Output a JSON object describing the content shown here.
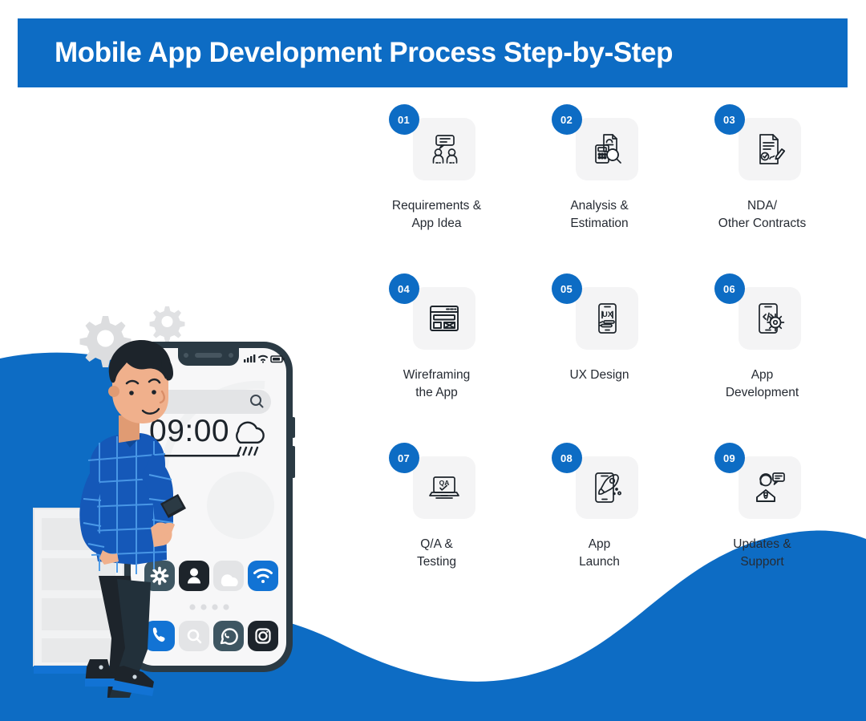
{
  "header": {
    "title": "Mobile App Development Process Step-by-Step",
    "background_color": "#0d6cc4",
    "text_color": "#ffffff"
  },
  "theme": {
    "brand_blue": "#0d6cc4",
    "tile_gray": "#f4f4f5",
    "text_dark": "#262b33",
    "dark_slate": "#2b3a44",
    "near_black": "#1d242b",
    "light_gray": "#e3e4e6"
  },
  "steps": [
    {
      "number": "01",
      "label": "Requirements &\nApp Idea",
      "icon": "people-chat-icon"
    },
    {
      "number": "02",
      "label": "Analysis &\nEstimation",
      "icon": "calculator-magnifier-icon"
    },
    {
      "number": "03",
      "label": "NDA/\nOther Contracts",
      "icon": "contract-signature-icon"
    },
    {
      "number": "04",
      "label": "Wireframing\nthe App",
      "icon": "wireframe-layout-icon"
    },
    {
      "number": "05",
      "label": "UX Design",
      "icon": "phone-ux-icon"
    },
    {
      "number": "06",
      "label": "App\nDevelopment",
      "icon": "phone-code-gear-icon"
    },
    {
      "number": "07",
      "label": "Q/A &\nTesting",
      "icon": "laptop-qa-icon"
    },
    {
      "number": "08",
      "label": "App\nLaunch",
      "icon": "phone-rocket-icon"
    },
    {
      "number": "09",
      "label": "Updates &\nSupport",
      "icon": "support-agent-icon"
    }
  ],
  "illustration": {
    "phone_screen": {
      "clock": "09:00",
      "search_placeholder": "",
      "weather_icon": "rain-cloud-icon",
      "status_icons": [
        "signal-bars-icon",
        "wifi-icon",
        "battery-icon"
      ],
      "app_icons": [
        {
          "name": "settings-gear-icon",
          "color": "#3e5662"
        },
        {
          "name": "contacts-person-icon",
          "color": "#1d242b"
        },
        {
          "name": "cloud-icon",
          "color": "#e3e4e6"
        },
        {
          "name": "wifi-app-icon",
          "color": "#1273d4"
        }
      ],
      "page_dots": 4,
      "dock_icons": [
        {
          "name": "phone-call-icon",
          "color": "#1273d4"
        },
        {
          "name": "search-app-icon",
          "color": "#e3e4e6"
        },
        {
          "name": "whatsapp-icon",
          "color": "#3e5662"
        },
        {
          "name": "instagram-icon",
          "color": "#1d242b"
        }
      ]
    },
    "character": "man-holding-phone",
    "props": [
      "gear-large-icon",
      "gear-small-icon",
      "filing-cabinet"
    ]
  }
}
